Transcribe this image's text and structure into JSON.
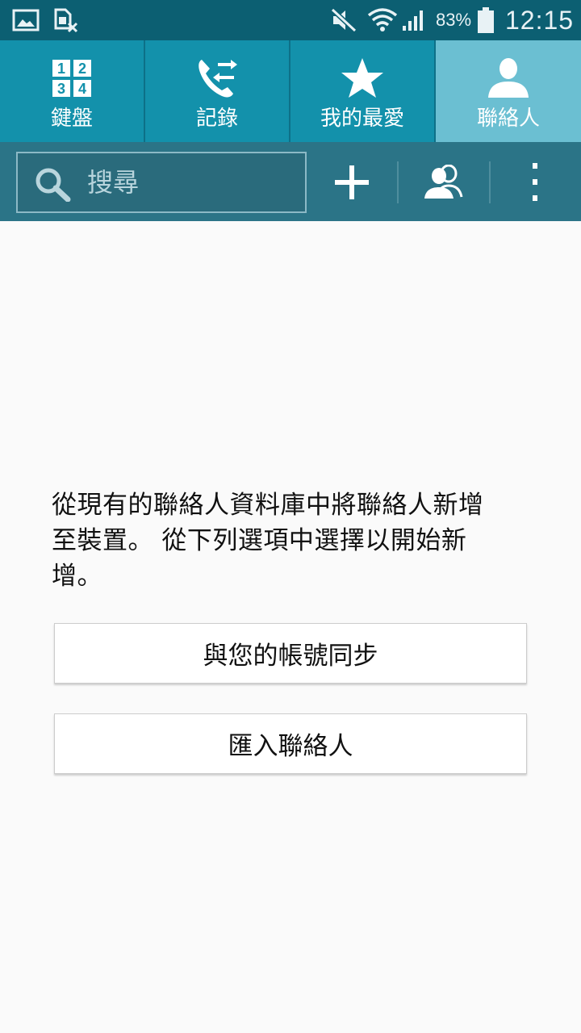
{
  "status_bar": {
    "battery_percent": "83%",
    "time": "12:15",
    "icons": [
      "gallery-icon",
      "sim-error-icon",
      "mute-icon",
      "wifi-icon",
      "signal-icon",
      "battery-icon"
    ]
  },
  "tabs": [
    {
      "label": "鍵盤",
      "icon": "keypad-icon",
      "active": false
    },
    {
      "label": "記錄",
      "icon": "call-log-icon",
      "active": false
    },
    {
      "label": "我的最愛",
      "icon": "star-icon",
      "active": false
    },
    {
      "label": "聯絡人",
      "icon": "person-icon",
      "active": true
    }
  ],
  "toolbar": {
    "search_placeholder": "搜尋",
    "add_icon": "plus-icon",
    "groups_icon": "groups-icon",
    "more_icon": "overflow-menu-icon"
  },
  "content": {
    "message_line1": "從現有的聯絡人資料庫中將聯絡人新增",
    "message_line2": "至裝置。 從下列選項中選擇以開始新",
    "message_line3": "增。",
    "sync_button": "與您的帳號同步",
    "import_button": "匯入聯絡人"
  },
  "colors": {
    "status_bar": "#0c5f72",
    "tab_bar": "#1391ab",
    "tab_active": "#6bbfd2",
    "toolbar": "#2b7487",
    "background": "#fafafa"
  }
}
